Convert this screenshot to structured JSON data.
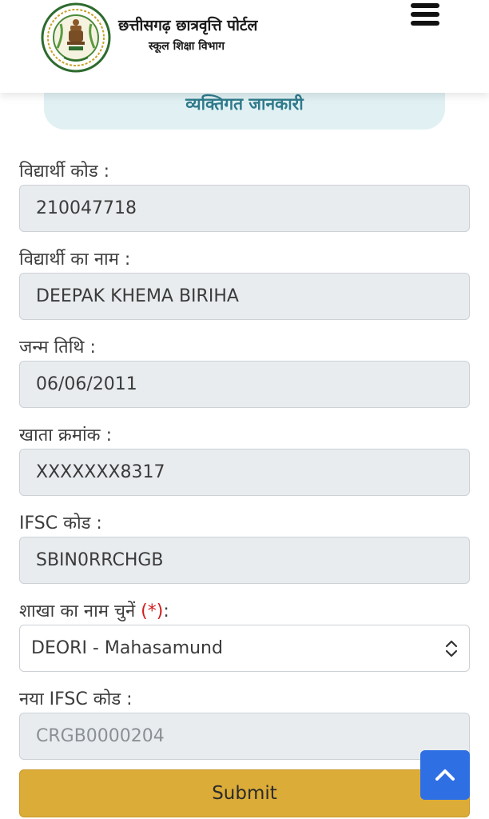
{
  "header": {
    "portal_title": "छत्तीसगढ़ छात्रवृत्ति पोर्टल",
    "portal_subtitle": "स्कूल शिक्षा विभाग",
    "logo_icon": "chhattisgarh-emblem",
    "menu_icon": "hamburger-menu-icon"
  },
  "section": {
    "title": "व्यक्तिगत जानकारी"
  },
  "fields": [
    {
      "label": "विद्यार्थी कोड :",
      "value": "210047718"
    },
    {
      "label": "विद्यार्थी का नाम :",
      "value": "DEEPAK KHEMA BIRIHA"
    },
    {
      "label": "जन्म तिथि :",
      "value": "06/06/2011"
    },
    {
      "label": "खाता क्रमांक :",
      "value": "XXXXXXX8317"
    },
    {
      "label": "IFSC कोड :",
      "value": "SBIN0RRCHGB"
    }
  ],
  "branch": {
    "label": "शाखा का नाम चुनें ",
    "required_mark": "(*)",
    "label_suffix": ":",
    "selected": "DEORI - Mahasamund"
  },
  "new_ifsc": {
    "label": "नया IFSC कोड :",
    "placeholder": "CRGB0000204"
  },
  "submit": {
    "label": "Submit"
  },
  "scroll_top_icon": "chevron-up-icon",
  "colors": {
    "submit_bg": "#dcac38",
    "scroll_top_bg": "#2f6fe4",
    "section_bg": "#e1f1f3",
    "section_text": "#2f7a8c",
    "required": "#d11e1e"
  }
}
